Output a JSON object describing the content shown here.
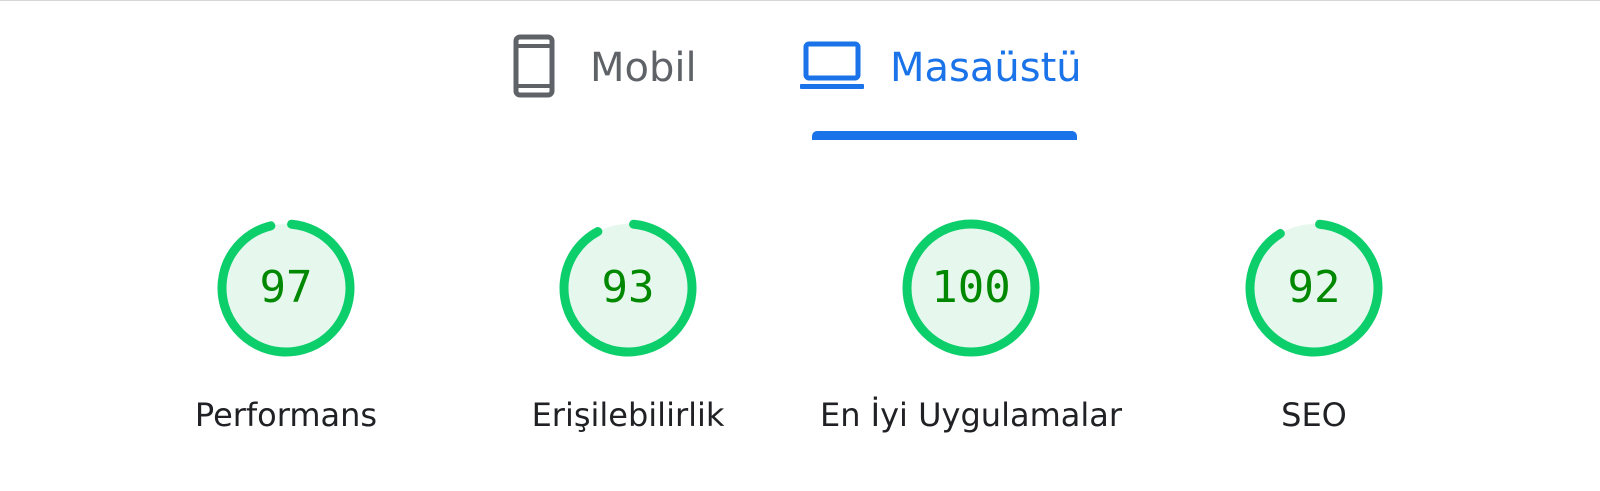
{
  "tabs": {
    "mobile": {
      "label": "Mobil",
      "icon": "smartphone-icon",
      "selected": false
    },
    "desktop": {
      "label": "Masaüstü",
      "icon": "laptop-icon",
      "selected": true
    }
  },
  "colors": {
    "accent": "#1a73e8",
    "inactive_tab": "#5f6368",
    "score_good_ring": "#0cce6b",
    "score_good_fill": "#e6f8ee",
    "score_good_text": "#008800",
    "label_text": "#202124"
  },
  "scores": [
    {
      "label": "Performans",
      "value": 97
    },
    {
      "label": "Erişilebilirlik",
      "value": 93
    },
    {
      "label": "En İyi Uygulamalar",
      "value": 100
    },
    {
      "label": "SEO",
      "value": 92
    }
  ]
}
